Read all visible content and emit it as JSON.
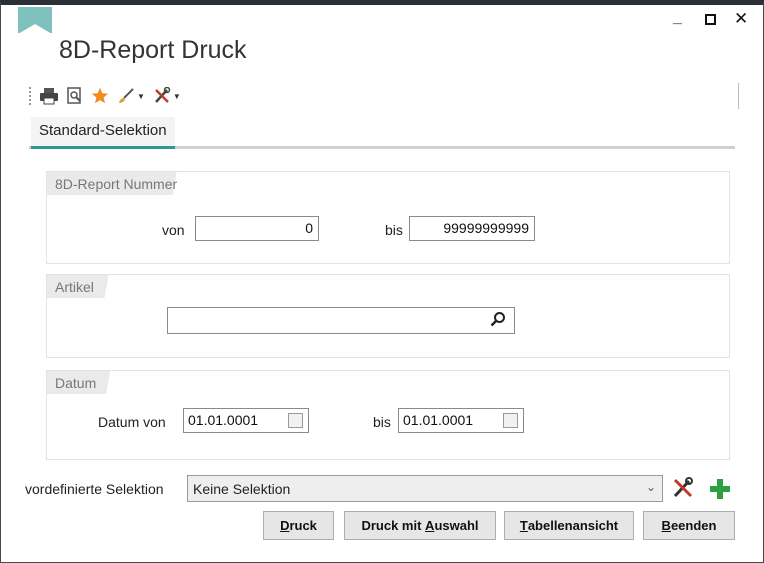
{
  "window": {
    "title": "8D-Report Druck",
    "controls": {
      "minimize": "_",
      "close": "✕"
    }
  },
  "toolbar": {
    "items": [
      "print-icon",
      "preview-icon",
      "favorite-star-icon",
      "brush-dropdown-icon",
      "tools-dropdown-icon"
    ]
  },
  "tabs": [
    {
      "label": "Standard-Selektion",
      "active": true
    }
  ],
  "groups": {
    "report_nummer": {
      "label": "8D-Report Nummer",
      "von_label": "von",
      "von_value": "0",
      "bis_label": "bis",
      "bis_value": "99999999999"
    },
    "artikel": {
      "label": "Artikel",
      "value": ""
    },
    "datum": {
      "label": "Datum",
      "von_label": "Datum von",
      "von_value": "01.01.0001",
      "bis_label": "bis",
      "bis_value": "01.01.0001"
    }
  },
  "selection": {
    "label": "vordefinierte Selektion",
    "value": "Keine Selektion"
  },
  "buttons": {
    "druck": {
      "prefix": "",
      "accel": "D",
      "suffix": "ruck"
    },
    "druck_auswahl": {
      "prefix": "Druck mit ",
      "accel": "A",
      "suffix": "uswahl"
    },
    "tabellenansicht": {
      "prefix": "",
      "accel": "T",
      "suffix": "abellenansicht"
    },
    "beenden": {
      "prefix": "",
      "accel": "B",
      "suffix": "eenden"
    }
  },
  "colors": {
    "accent": "#2b9b9a",
    "bookmark": "#7fc2bd",
    "add_green": "#2ea043",
    "star_orange": "#f28a1e"
  }
}
